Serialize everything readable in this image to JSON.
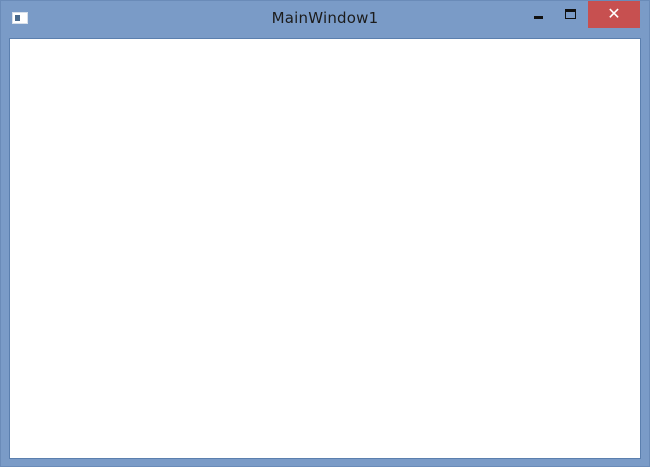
{
  "window": {
    "title": "MainWindow1",
    "controls": {
      "minimize_icon": "minimize-icon",
      "maximize_icon": "maximize-icon",
      "close_glyph": "✕"
    },
    "colors": {
      "frame": "#7a9bc7",
      "close_button": "#c75050",
      "client": "#ffffff"
    }
  }
}
